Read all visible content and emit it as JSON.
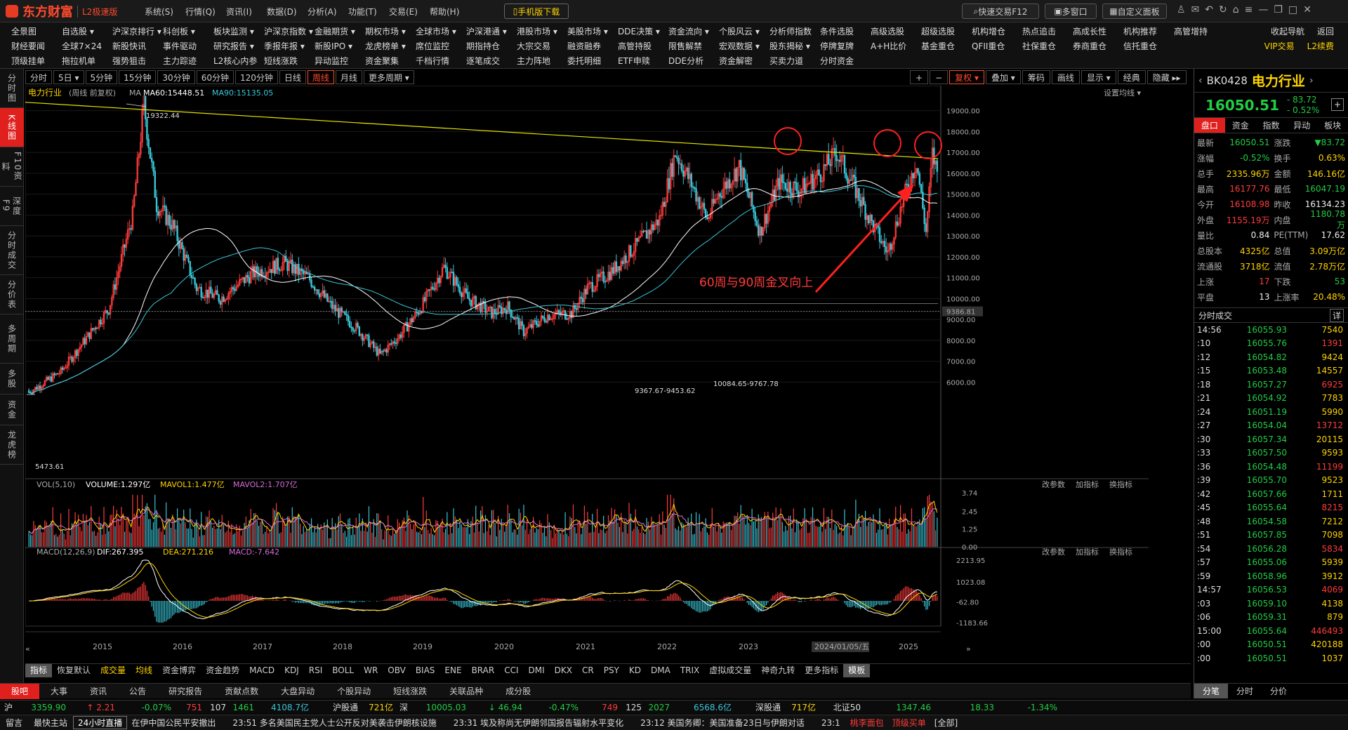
{
  "app": {
    "logo_text": "东方财富",
    "version_text": "L2极速版",
    "menu": [
      "系统(S)",
      "行情(Q)",
      "资讯(I)",
      "数据(D)",
      "分析(A)",
      "功能(T)",
      "交易(E)",
      "帮助(H)"
    ],
    "mobile_download": "手机版下载",
    "quick_trade": "快速交易F12",
    "multi_window": "多窗口",
    "custom_panel": "自定义面板"
  },
  "nav": {
    "row1": [
      "全景图",
      "自选股 ▾",
      "沪深京排行 ▾",
      "科创板 ▾",
      "板块监测 ▾",
      "沪深京指数 ▾",
      "金融期货 ▾",
      "期权市场 ▾",
      "全球市场 ▾",
      "沪深港通 ▾",
      "港股市场 ▾",
      "美股市场 ▾",
      "DDE决策 ▾",
      "资金流向 ▾",
      "个股风云 ▾",
      "分析师指数",
      "条件选股",
      "高级选股",
      "超级选股",
      "机构增仓",
      "热点追击",
      "高成长性",
      "机构推荐",
      "高管增持"
    ],
    "row2": [
      "财经要闻",
      "全球7×24",
      "新股快讯",
      "事件驱动",
      "研究报告 ▾",
      "季报年报 ▾",
      "新股IPO ▾",
      "龙虎榜单 ▾",
      "席位监控",
      "期指持仓",
      "大宗交易",
      "融资融券",
      "高管持股",
      "限售解禁",
      "宏观数据 ▾",
      "股东揭秘 ▾",
      "停牌复牌",
      "A+H比价",
      "基金重仓",
      "QFII重仓",
      "社保重仓",
      "券商重仓",
      "信托重仓"
    ],
    "row3": [
      "顶级挂单",
      "拖拉机单",
      "强势狙击",
      "主力踪迹",
      "L2核心内参",
      "短线涨跌",
      "异动监控",
      "资金聚集",
      "千档行情",
      "逐笔成交",
      "主力阵地",
      "委托明细",
      "ETF申赎",
      "DDE分析",
      "资金解密",
      "买卖力道",
      "分时资金"
    ],
    "right1": [
      "收起导航",
      "返回"
    ],
    "right2": [
      "VIP交易",
      "L2续费"
    ]
  },
  "left_rail": [
    "分时图",
    "K线图",
    "F10资料",
    "深度F9",
    "分时成交",
    "分价表",
    "多周期",
    "多股",
    "资金",
    "龙虎榜"
  ],
  "periods": [
    "分时",
    "5日 ▾",
    "5分钟",
    "15分钟",
    "30分钟",
    "60分钟",
    "120分钟",
    "日线",
    "周线",
    "月线",
    "更多周期 ▾"
  ],
  "period_active": "周线",
  "right_tools": [
    "+",
    "−",
    "复权 ▾",
    "叠加 ▾",
    "筹码",
    "画线",
    "显示 ▾",
    "经典",
    "隐藏 ▸▸"
  ],
  "main_legend": {
    "name": "电力行业",
    "period": "(周线 前复权)",
    "ma_label": "MA",
    "ma60": "MA60:15448.51",
    "ma90": "MA90:15135.05",
    "settings": "设置均线 ▾",
    "annotation": "60周与90周金叉向上"
  },
  "vol_legend": {
    "label": "VOL(5,10)",
    "volume": "VOLUME:1.297亿",
    "mavol1": "MAVOL1:1.477亿",
    "mavol2": "MAVOL2:1.707亿"
  },
  "macd_legend": {
    "label": "MACD(12,26,9)",
    "dif": "DIF:267.395",
    "dea": "DEA:271.216",
    "macd": "MACD:-7.642"
  },
  "panel_tools": [
    "改参数",
    "加指标",
    "换指标"
  ],
  "price_axis": [
    "19000.00",
    "18000.00",
    "17000.00",
    "16000.00",
    "15000.00",
    "14000.00",
    "13000.00",
    "12000.00",
    "11000.00",
    "10000.00",
    "9386.81",
    "9000.00",
    "8000.00",
    "7000.00",
    "6000.00"
  ],
  "vol_axis": [
    "3.74",
    "2.45",
    "1.25",
    "0.00"
  ],
  "macd_axis": [
    "2213.95",
    "1023.08",
    "-62.80",
    "-1183.66"
  ],
  "time_axis": [
    "2015",
    "2016",
    "2017",
    "2018",
    "2019",
    "2020",
    "2021",
    "2022",
    "2023",
    "2024/01/05/五",
    "2025"
  ],
  "price_labels": {
    "high": "19322.44",
    "low": "5473.61",
    "mid1": "9367.67-9453.62",
    "mid2": "10084.65-9767.78"
  },
  "chart_data": {
    "type": "candlestick",
    "title": "电力行业",
    "ylim": [
      5473.61,
      19322.44
    ],
    "key_points": [
      {
        "x": "2015",
        "y": 19322.44
      },
      {
        "x": "2014",
        "y": 5473.61
      }
    ],
    "series": [
      {
        "name": "MA60",
        "last": 15448.51
      },
      {
        "name": "MA90",
        "last": 15135.05
      }
    ],
    "volume_last": {
      "VOLUME": "1.297亿",
      "MAVOL1": "1.477亿",
      "MAVOL2": "1.707亿"
    },
    "macd_last": {
      "DIF": 267.395,
      "DEA": 271.216,
      "MACD": -7.642
    }
  },
  "indicator_tabs": [
    "指标",
    "恢复默认",
    "成交量",
    "均线",
    "资金博弈",
    "资金趋势",
    "MACD",
    "KDJ",
    "RSI",
    "BOLL",
    "WR",
    "OBV",
    "BIAS",
    "ENE",
    "BRAR",
    "CCI",
    "DMI",
    "DKX",
    "CR",
    "PSY",
    "KD",
    "DMA",
    "TRIX",
    "虚拟成交量",
    "神奇九转",
    "更多指标",
    "模板"
  ],
  "news_tabs": [
    "股吧",
    "大事",
    "资讯",
    "公告",
    "研究报告",
    "贡献点数",
    "大盘异动",
    "个股异动",
    "短线涨跌",
    "关联品种",
    "成分股"
  ],
  "status": {
    "sh_label": "沪",
    "sh_index": "3359.90",
    "sh_chg": "↑ 2.21",
    "sh_pct": "-0.07%",
    "sh_up": "751",
    "sh_flat": "107",
    "sh_down": "1461",
    "sh_amt": "4108.7亿",
    "hgt_label": "沪股通",
    "hgt_val": "721亿",
    "sz_label": "深",
    "sz_index": "10005.03",
    "sz_chg": "↓ 46.94",
    "sz_pct": "-0.47%",
    "sz_up": "749",
    "sz_flat": "125",
    "sz_down": "2027",
    "sz_amt": "6568.6亿",
    "sgt_label": "深股通",
    "sgt_val": "717亿",
    "bz_label": "北证50",
    "bz_index": "1347.46",
    "bz_chg": "18.33",
    "bz_pct": "-1.34%"
  },
  "ticker": {
    "msg": "留言",
    "mine": "最快主站",
    "live": "24小时直播",
    "items": [
      "在伊中国公民平安撤出",
      "23:51 多名美国民主党人士公开反对美袭击伊朗核设施",
      "23:31 埃及称尚无伊朗邻国报告辐射水平变化",
      "23:12 美国务卿：美国准备23日与伊朗对话",
      "23:1"
    ],
    "right": [
      "桃李面包",
      "顶级买单",
      "[全部]"
    ]
  },
  "quote": {
    "code": "BK0428",
    "name": "电力行业",
    "price": "16050.51",
    "chg": "- 83.72",
    "pct": "- 0.52%",
    "tabs": [
      "盘口",
      "资金",
      "指数",
      "异动",
      "板块"
    ],
    "rows": [
      [
        "最新",
        "16050.51",
        "涨跌",
        "▼83.72"
      ],
      [
        "涨幅",
        "-0.52%",
        "换手",
        "0.63%"
      ],
      [
        "总手",
        "2335.96万",
        "金额",
        "146.16亿"
      ],
      [
        "最高",
        "16177.76",
        "最低",
        "16047.19"
      ],
      [
        "今开",
        "16108.98",
        "昨收",
        "16134.23"
      ],
      [
        "外盘",
        "1155.19万",
        "内盘",
        "1180.78万"
      ],
      [
        "量比",
        "0.84",
        "PE(TTM)",
        "17.62"
      ],
      [
        "总股本",
        "4325亿",
        "总值",
        "3.09万亿"
      ],
      [
        "流通股",
        "3718亿",
        "流值",
        "2.78万亿"
      ],
      [
        "上涨",
        "17",
        "下跌",
        "53"
      ],
      [
        "平盘",
        "13",
        "上涨率",
        "20.48%"
      ]
    ],
    "trades_title": "分时成交",
    "trades_btn": "详",
    "trades": [
      [
        "14:56",
        "16055.93",
        "7540"
      ],
      [
        ":10",
        "16055.76",
        "1391"
      ],
      [
        ":12",
        "16054.82",
        "9424"
      ],
      [
        ":15",
        "16053.48",
        "14557"
      ],
      [
        ":18",
        "16057.27",
        "6925"
      ],
      [
        ":21",
        "16054.92",
        "7783"
      ],
      [
        ":24",
        "16051.19",
        "5990"
      ],
      [
        ":27",
        "16054.04",
        "13712"
      ],
      [
        ":30",
        "16057.34",
        "20115"
      ],
      [
        ":33",
        "16057.50",
        "9593"
      ],
      [
        ":36",
        "16054.48",
        "11199"
      ],
      [
        ":39",
        "16055.70",
        "9523"
      ],
      [
        ":42",
        "16057.66",
        "1711"
      ],
      [
        ":45",
        "16055.64",
        "8215"
      ],
      [
        ":48",
        "16054.58",
        "7212"
      ],
      [
        ":51",
        "16057.85",
        "7098"
      ],
      [
        ":54",
        "16056.28",
        "5834"
      ],
      [
        ":57",
        "16055.06",
        "5939"
      ],
      [
        ":59",
        "16058.96",
        "3912"
      ],
      [
        "14:57",
        "16056.53",
        "4069"
      ],
      [
        ":03",
        "16059.10",
        "4138"
      ],
      [
        ":06",
        "16059.31",
        "879"
      ],
      [
        "15:00",
        "16055.64",
        "446493"
      ],
      [
        ":00",
        "16050.51",
        "420188"
      ],
      [
        ":00",
        "16050.51",
        "1037"
      ]
    ],
    "bottom_tabs": [
      "分笔",
      "分时",
      "分价"
    ]
  }
}
